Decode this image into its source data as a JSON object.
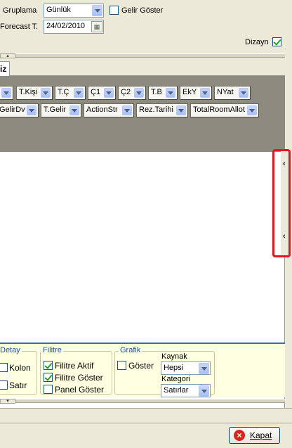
{
  "filters": {
    "gruplama_label": "Gruplama",
    "gruplama_value": "Günlük",
    "gelir_goster_label": "Gelir Göster",
    "gelir_goster_checked": false,
    "forecast_label": "Forecast T.",
    "forecast_value": "24/02/2010",
    "dizayn_label": "Dizayn",
    "dizayn_checked": true
  },
  "tabs": [
    {
      "label": "iz"
    }
  ],
  "columns_row1": [
    {
      "label": ""
    },
    {
      "label": "T.Kişi"
    },
    {
      "label": "T.Ç"
    },
    {
      "label": "Ç1"
    },
    {
      "label": "Ç2"
    },
    {
      "label": "T.B"
    },
    {
      "label": "EkY"
    },
    {
      "label": "NYat"
    }
  ],
  "columns_row2": [
    {
      "label": "GelirDv"
    },
    {
      "label": "T.Gelir"
    },
    {
      "label": "ActionStr"
    },
    {
      "label": "Rez.Tarihi"
    },
    {
      "label": "TotalRoomAllot"
    }
  ],
  "options": {
    "detay": {
      "title": "Detay",
      "kolon_label": "Kolon",
      "satir_label": "Satır"
    },
    "filitre": {
      "title": "Filitre",
      "aktif_label": "Filitre Aktif",
      "aktif_checked": true,
      "goster_label": "Filitre Göster",
      "goster_checked": true,
      "panel_label": "Panel Göster",
      "panel_checked": false
    },
    "grafik": {
      "title": "Grafik",
      "goster_label": "Göster",
      "kaynak_label": "Kaynak",
      "kaynak_value": "Hepsi",
      "kategori_label": "Kategori",
      "kategori_value": "Satırlar"
    }
  },
  "footer": {
    "close_label": "Kapat"
  },
  "colors": {
    "highlight": "#e4151c",
    "group_panel": "#8d8b7f",
    "options_bg": "#ffffe1"
  }
}
